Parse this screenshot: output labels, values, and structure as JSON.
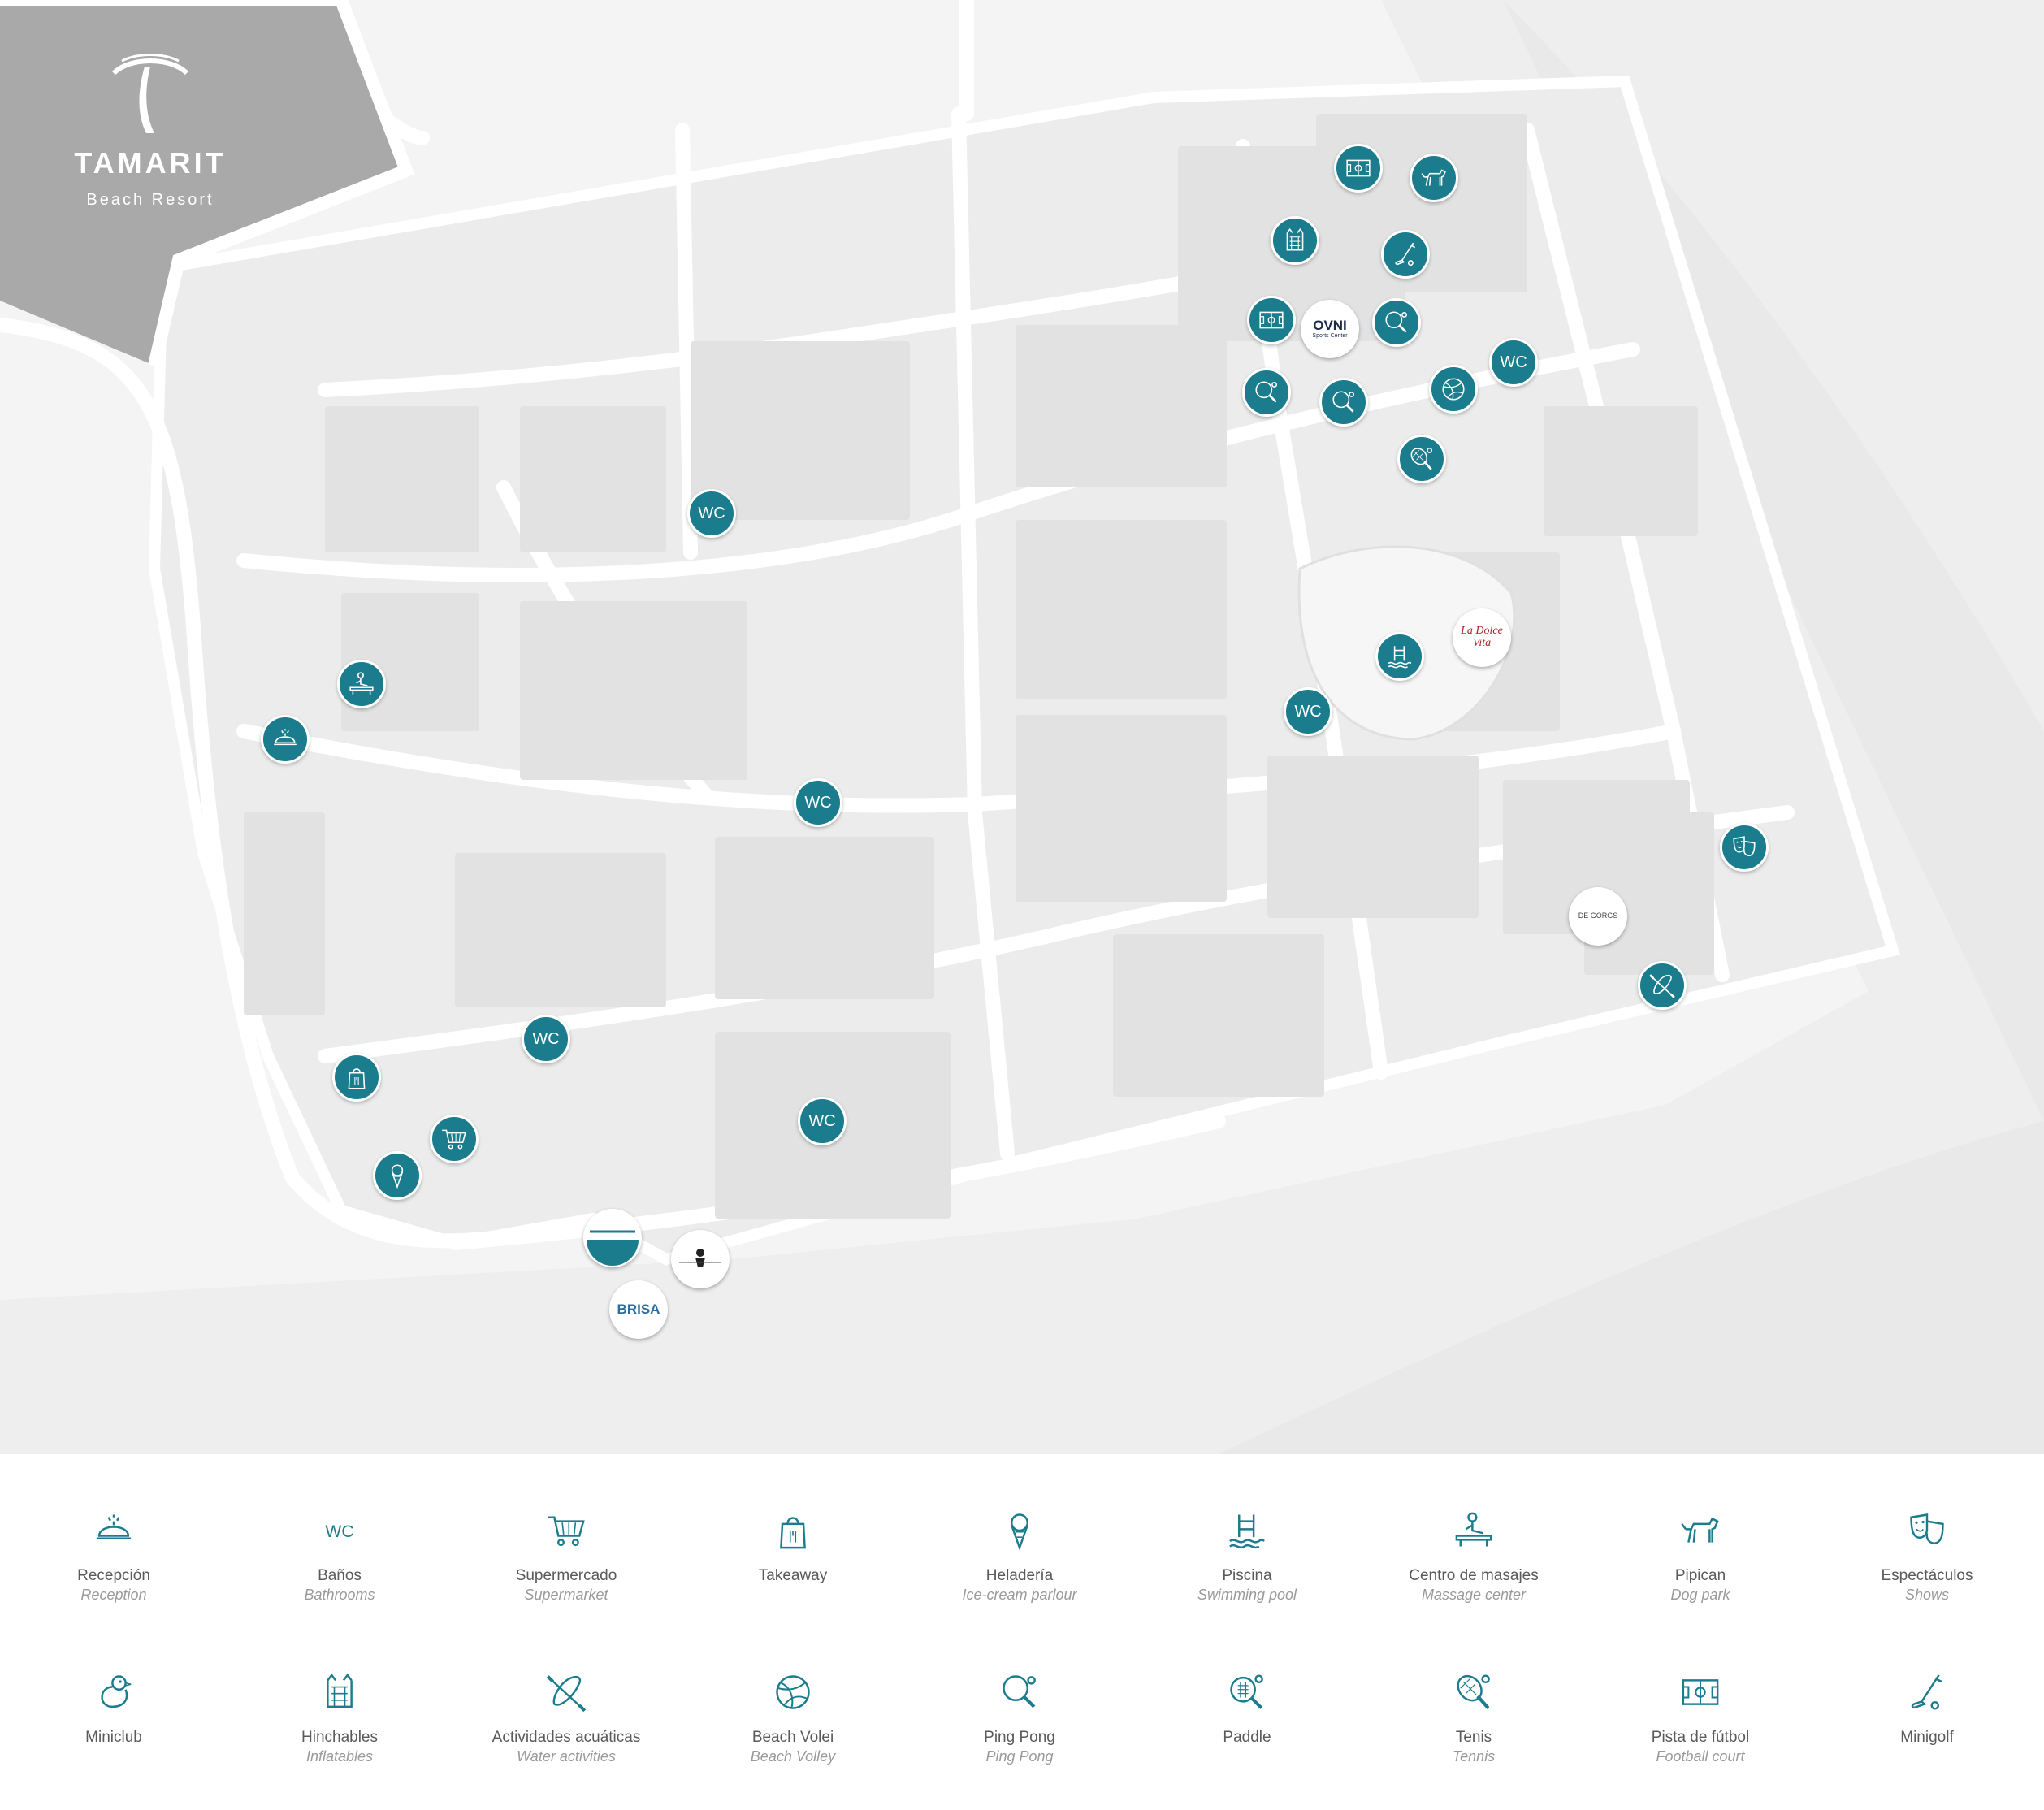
{
  "brand": {
    "name": "TAMARIT",
    "subtitle": "Beach Resort"
  },
  "map_markers": [
    {
      "icon": "football-court-icon",
      "label": ""
    },
    {
      "icon": "dog-park-icon",
      "label": ""
    },
    {
      "icon": "inflatables-icon",
      "label": ""
    },
    {
      "icon": "minigolf-icon",
      "label": ""
    },
    {
      "icon": "football-court-icon",
      "label": ""
    },
    {
      "icon": "ping-pong-icon",
      "label": ""
    },
    {
      "icon": "wc-icon",
      "label": "WC"
    },
    {
      "icon": "ping-pong-icon",
      "label": ""
    },
    {
      "icon": "ping-pong-icon",
      "label": ""
    },
    {
      "icon": "beach-volley-icon",
      "label": ""
    },
    {
      "icon": "tennis-icon",
      "label": ""
    },
    {
      "icon": "wc-icon",
      "label": "WC"
    },
    {
      "icon": "swimming-pool-icon",
      "label": ""
    },
    {
      "icon": "wc-icon",
      "label": "WC"
    },
    {
      "icon": "massage-icon",
      "label": ""
    },
    {
      "icon": "reception-icon",
      "label": ""
    },
    {
      "icon": "wc-icon",
      "label": "WC"
    },
    {
      "icon": "shows-icon",
      "label": ""
    },
    {
      "icon": "water-activities-icon",
      "label": ""
    },
    {
      "icon": "wc-icon",
      "label": "WC"
    },
    {
      "icon": "takeaway-icon",
      "label": ""
    },
    {
      "icon": "supermarket-icon",
      "label": ""
    },
    {
      "icon": "wc-icon",
      "label": "WC"
    },
    {
      "icon": "ice-cream-icon",
      "label": ""
    }
  ],
  "venues": [
    {
      "name": "OVNI",
      "sub": "Sports Center"
    },
    {
      "name": "La Dolce Vita",
      "sub": ""
    },
    {
      "name": "DE GORGS",
      "sub": ""
    },
    {
      "name": "BRISA",
      "sub": ""
    }
  ],
  "legend": [
    {
      "icon": "reception-icon",
      "es": "Recepción",
      "en": "Reception"
    },
    {
      "icon": "wc-icon",
      "es": "Baños",
      "en": "Bathrooms"
    },
    {
      "icon": "supermarket-icon",
      "es": "Supermercado",
      "en": "Supermarket"
    },
    {
      "icon": "takeaway-icon",
      "es": "Takeaway",
      "en": ""
    },
    {
      "icon": "ice-cream-icon",
      "es": "Heladería",
      "en": "Ice-cream parlour"
    },
    {
      "icon": "swimming-pool-icon",
      "es": "Piscina",
      "en": "Swimming pool"
    },
    {
      "icon": "massage-icon",
      "es": "Centro de masajes",
      "en": "Massage center"
    },
    {
      "icon": "dog-park-icon",
      "es": "Pipican",
      "en": "Dog park"
    },
    {
      "icon": "shows-icon",
      "es": "Espectáculos",
      "en": "Shows"
    },
    {
      "icon": "miniclub-icon",
      "es": "Miniclub",
      "en": ""
    },
    {
      "icon": "inflatables-icon",
      "es": "Hinchables",
      "en": "Inflatables"
    },
    {
      "icon": "water-activities-icon",
      "es": "Actividades acuáticas",
      "en": "Water activities"
    },
    {
      "icon": "beach-volley-icon",
      "es": "Beach Volei",
      "en": "Beach Volley"
    },
    {
      "icon": "ping-pong-icon",
      "es": "Ping Pong",
      "en": "Ping Pong"
    },
    {
      "icon": "paddle-icon",
      "es": "Paddle",
      "en": ""
    },
    {
      "icon": "tennis-icon",
      "es": "Tenis",
      "en": "Tennis"
    },
    {
      "icon": "football-court-icon",
      "es": "Pista de fútbol",
      "en": "Football court"
    },
    {
      "icon": "minigolf-icon",
      "es": "Minigolf",
      "en": ""
    }
  ],
  "colors": {
    "accent": "#1a7c8c",
    "map_bg": "#f4f4f4",
    "brand_bg": "#a9a9a9",
    "road": "#ffffff",
    "sand": "#ececec"
  }
}
